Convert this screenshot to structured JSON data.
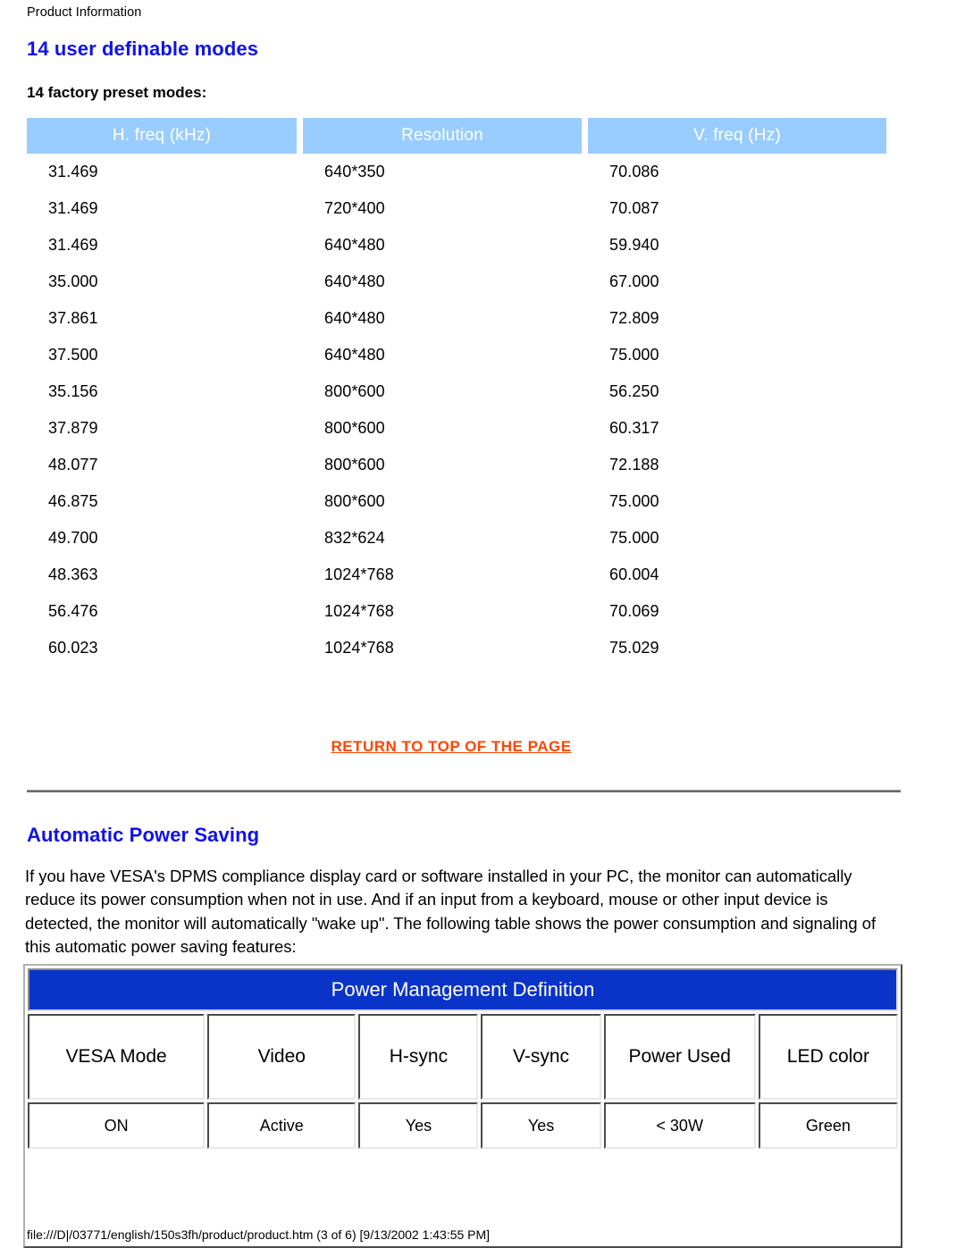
{
  "document": {
    "running_header": "Product Information",
    "footer": "file:///D|/03771/english/150s3fh/product/product.htm (3 of 6) [9/13/2002 1:43:55 PM]"
  },
  "sections": {
    "user_modes": {
      "heading": "14 user definable modes",
      "subheading": "14 factory preset modes:"
    },
    "power_saving": {
      "heading": "Automatic Power Saving",
      "paragraph": "If you have VESA's DPMS compliance display card or software installed in your PC, the monitor can automatically reduce its power consumption when not in use. And if an input from a keyboard, mouse or other input device is detected, the monitor will automatically \"wake up\". The following table shows the power consumption and signaling of this automatic power saving features:"
    }
  },
  "return_top_link": "RETURN TO TOP OF THE PAGE",
  "preset_modes_table": {
    "headers": [
      "H. freq (kHz)",
      "Resolution",
      "V. freq (Hz)"
    ],
    "rows": [
      [
        "31.469",
        "640*350",
        "70.086"
      ],
      [
        "31.469",
        "720*400",
        "70.087"
      ],
      [
        "31.469",
        "640*480",
        "59.940"
      ],
      [
        "35.000",
        "640*480",
        "67.000"
      ],
      [
        "37.861",
        "640*480",
        "72.809"
      ],
      [
        "37.500",
        "640*480",
        "75.000"
      ],
      [
        "35.156",
        "800*600",
        "56.250"
      ],
      [
        "37.879",
        "800*600",
        "60.317"
      ],
      [
        "48.077",
        "800*600",
        "72.188"
      ],
      [
        "46.875",
        "800*600",
        "75.000"
      ],
      [
        "49.700",
        "832*624",
        "75.000"
      ],
      [
        "48.363",
        "1024*768",
        "60.004"
      ],
      [
        "56.476",
        "1024*768",
        "70.069"
      ],
      [
        "60.023",
        "1024*768",
        "75.029"
      ]
    ]
  },
  "power_management_table": {
    "title": "Power Management Definition",
    "headers": [
      "VESA Mode",
      "Video",
      "H-sync",
      "V-sync",
      "Power Used",
      "LED color"
    ],
    "rows": [
      [
        "ON",
        "Active",
        "Yes",
        "Yes",
        "< 30W",
        "Green"
      ]
    ]
  },
  "colors": {
    "heading_blue": "#1111EE",
    "table_header_blue": "#99CCFF",
    "pm_title_blue": "#0A33C8",
    "link_orange": "#FF4500"
  }
}
